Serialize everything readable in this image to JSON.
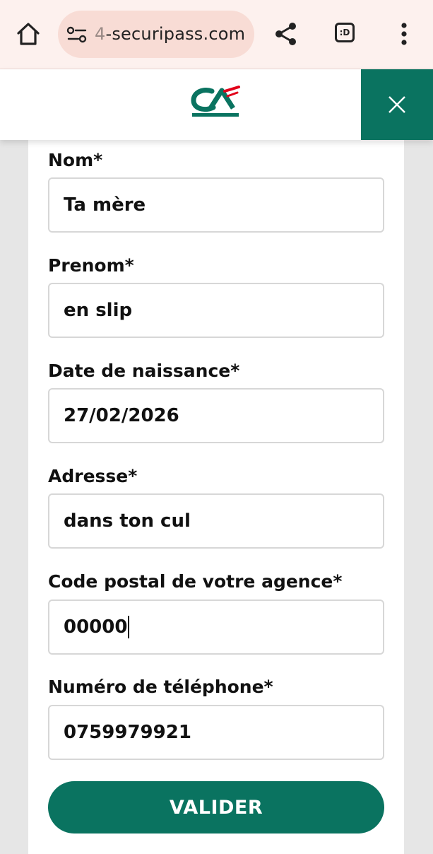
{
  "browser": {
    "url_prefix": "4",
    "url_main": "-securipass.com",
    "tab_indicator": ":D"
  },
  "form": {
    "fields": [
      {
        "label": "Nom*",
        "value": "Ta mère"
      },
      {
        "label": "Prenom*",
        "value": "en slip"
      },
      {
        "label": "Date de naissance*",
        "value": "27/02/2026"
      },
      {
        "label": "Adresse*",
        "value": "dans ton cul"
      },
      {
        "label": "Code postal de votre agence*",
        "value": "00000"
      },
      {
        "label": "Numéro de téléphone*",
        "value": "0759979921"
      }
    ],
    "submit_label": "VALIDER"
  },
  "colors": {
    "brand_green": "#0a7360",
    "logo_red": "#e2001a",
    "browser_bar": "#fdf1ee",
    "url_pill": "#f8dcd5"
  },
  "icons": [
    "home-icon",
    "site-settings-icon",
    "share-icon",
    "tab-switcher-icon",
    "more-menu-icon",
    "close-icon",
    "credit-agricole-logo"
  ]
}
